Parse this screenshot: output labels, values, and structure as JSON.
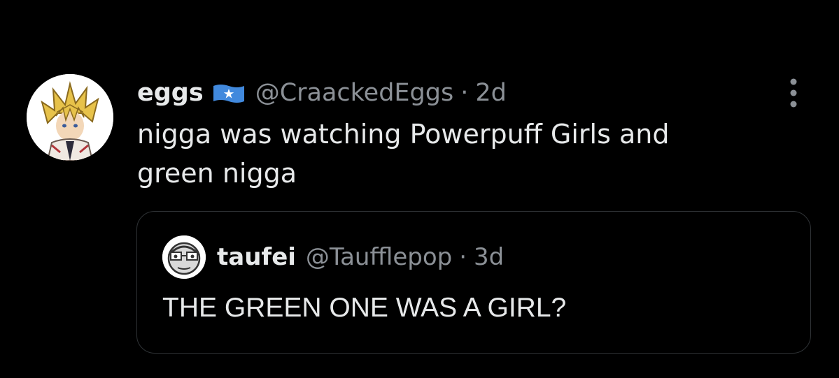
{
  "tweet": {
    "author_name": "eggs",
    "flag_icon": "somalia-flag-icon",
    "handle": "@CraackedEggs",
    "separator": "·",
    "time": "2d",
    "text": "nigga was watching Powerpuff Girls and\ngreen nigga",
    "more_icon": "more-options-icon"
  },
  "quoted_tweet": {
    "author_name": "taufei",
    "handle": "@Taufflepop",
    "separator": "·",
    "time": "3d",
    "text": "THE GREEN ONE WAS A GIRL?"
  },
  "colors": {
    "background": "#000000",
    "primary_text": "#e7e9ea",
    "secondary_text": "#8b9096",
    "border": "#2f3336",
    "flag_blue": "#4189dd"
  }
}
